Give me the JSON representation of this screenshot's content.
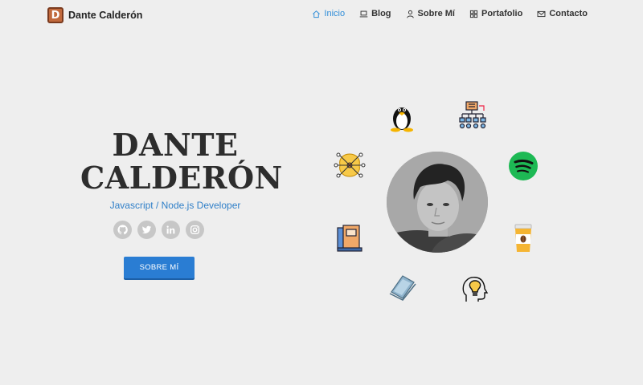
{
  "brand": {
    "logo_letter": "D",
    "name": "Dante Calderón"
  },
  "nav": {
    "items": [
      {
        "label": "Inicio",
        "icon": "home-icon",
        "active": true
      },
      {
        "label": "Blog",
        "icon": "laptop-icon"
      },
      {
        "label": "Sobre Mí",
        "icon": "user-icon"
      },
      {
        "label": "Portafolio",
        "icon": "grid-icon"
      },
      {
        "label": "Contacto",
        "icon": "mail-icon"
      }
    ]
  },
  "hero": {
    "name_line1": "DANTE",
    "name_line2": "CALDERÓN",
    "role": "Javascript / Node.js Developer",
    "cta_label": "SOBRE MÍ",
    "socials": [
      "github-icon",
      "twitter-icon",
      "linkedin-icon",
      "instagram-icon"
    ]
  },
  "orbit_icons": [
    "linux-tux-icon",
    "network-diagram-icon",
    "spotify-icon",
    "coffee-cup-icon",
    "idea-head-icon",
    "laptop-icon",
    "books-icon",
    "neural-brain-icon"
  ],
  "colors": {
    "accent": "#2f8dd8",
    "button": "#2a7dd3",
    "background": "#eeeeee",
    "social_bg": "#c7c7c7"
  }
}
